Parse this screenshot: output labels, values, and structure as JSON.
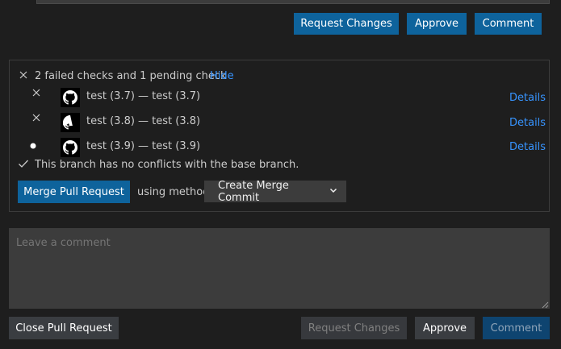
{
  "review_buttons_top": {
    "request_changes": "Request Changes",
    "approve": "Approve",
    "comment": "Comment"
  },
  "status": {
    "summary": "2 failed checks and 1 pending check",
    "hide_link": "Hide",
    "checks": [
      {
        "state": "failed",
        "label": "test (3.7) — test (3.7)",
        "details": "Details"
      },
      {
        "state": "failed",
        "label": "test (3.8) — test (3.8)",
        "details": "Details"
      },
      {
        "state": "pending",
        "label": "test (3.9) — test (3.9)",
        "details": "Details"
      }
    ],
    "conflicts": "This branch has no conflicts with the base branch."
  },
  "merge": {
    "button": "Merge Pull Request",
    "using_method": "using method",
    "method_selected": "Create Merge Commit"
  },
  "comment": {
    "placeholder": "Leave a comment"
  },
  "footer": {
    "close_pr": "Close Pull Request",
    "request_changes": "Request Changes",
    "approve": "Approve",
    "comment": "Comment"
  },
  "colors": {
    "background": "#1e1e1e",
    "primary_button": "#0e639c",
    "secondary_button": "#3a3d41",
    "link": "#3794ff",
    "input_bg": "#3c3c3c"
  }
}
